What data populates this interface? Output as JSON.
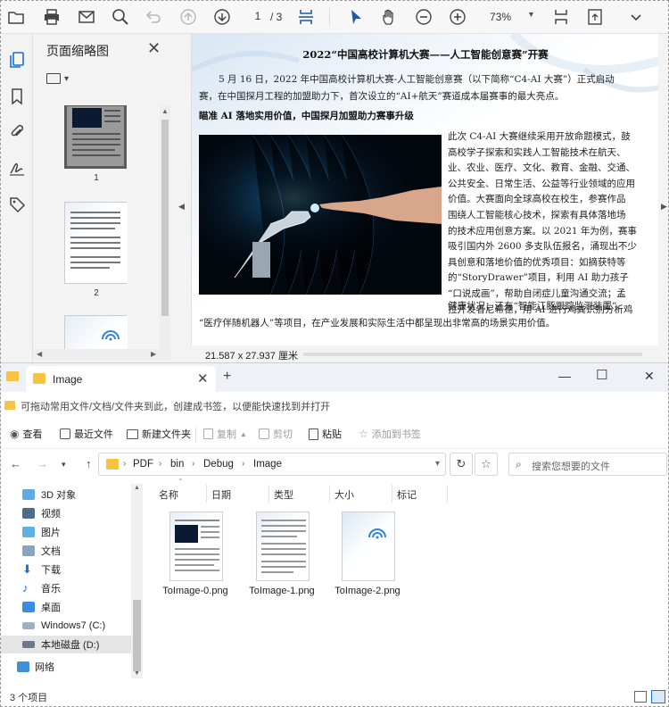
{
  "pdf": {
    "page_current": "1",
    "page_total": "/ 3",
    "zoom": "73%",
    "thumbnails_title": "页面缩略图",
    "thumb_numbers": [
      "1",
      "2"
    ],
    "doc_size": "21.587 x 27.937 厘米",
    "doc": {
      "title": "2022“中国高校计算机大赛——人工智能创意赛”开赛",
      "p1_line1": "5 月 16 日，2022 年中国高校计算机大赛-人工智能创意赛（以下简称“C4-AI 大赛”）正式启动",
      "p1_line2": "赛，在中国探月工程的加盟助力下，首次设立的“AI+航天”赛道成本届赛事的最大亮点。",
      "heading": "瞄准 AI 落地实用价值，中国探月加盟助力赛事升级",
      "side_lines": [
        "此次 C4-AI 大赛继续采用开放命题模式，鼓",
        "高校学子探索和实践人工智能技术在航天、",
        "业、农业、医疗、文化、教育、金融、交通、",
        "公共安全、日常生活、公益等行业领域的应用",
        "价值。大赛面向全球高校在校生，参赛作品",
        "围绕人工智能核心技术，探索有具体落地场",
        "的技术应用创意方案。以 2021 年为例，赛事",
        "吸引国内外 2600 多支队伍报名，涌现出不少",
        "具创意和落地价值的优秀项目：如摘获特等",
        "的“StoryDrawer”项目，利用 AI 助力孩子",
        "“口说成画”，帮助自闭症儿童沟通交流；孟",
        "拉开发者尼希德，用 AI 进行鸡粪识别分析鸡",
        "健康状况；还有“智能江豚跟踪监测装置”、"
      ],
      "last_line": "“医疗伴随机器人”等项目，在产业发展和实际生活中都呈现出非常高的场景实用价值。"
    }
  },
  "explorer": {
    "tab_label": "Image",
    "hint": "可拖动常用文件/文档/文件夹到此，创建成书签，以便能快速找到并打开",
    "toolbar": {
      "view": "查看",
      "recent": "最近文件",
      "new_folder": "新建文件夹",
      "copy": "复制",
      "cut": "剪切",
      "paste": "粘贴",
      "add_bookmark": "添加到书签"
    },
    "breadcrumb": [
      "PDF",
      "bin",
      "Debug",
      "Image"
    ],
    "search_placeholder": "搜索您想要的文件",
    "tree": [
      "3D 对象",
      "视频",
      "图片",
      "文档",
      "下载",
      "音乐",
      "桌面",
      "Windows7 (C:)",
      "本地磁盘 (D:)",
      "网络"
    ],
    "columns": [
      "名称",
      "日期",
      "类型",
      "大小",
      "标记"
    ],
    "files": [
      "ToImage-0.png",
      "ToImage-1.png",
      "ToImage-2.png"
    ],
    "status": "3 个项目"
  }
}
